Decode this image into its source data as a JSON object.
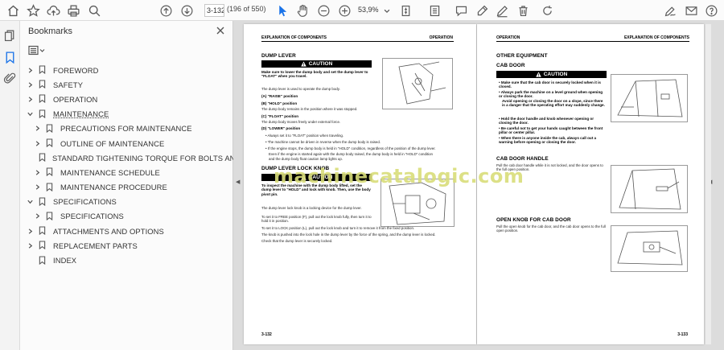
{
  "toolbar": {
    "page_value": "3-132",
    "page_count": "(196 of 550)",
    "zoom_value": "53,9%"
  },
  "sidebar_panel": {
    "title": "Bookmarks",
    "items": [
      {
        "label": "FOREWORD",
        "level": 0,
        "chevron": "right"
      },
      {
        "label": "SAFETY",
        "level": 0,
        "chevron": "right"
      },
      {
        "label": "OPERATION",
        "level": 0,
        "chevron": "right"
      },
      {
        "label": "MAINTENANCE",
        "level": 0,
        "chevron": "down"
      },
      {
        "label": "PRECAUTIONS FOR MAINTENANCE",
        "level": 1,
        "chevron": "right"
      },
      {
        "label": "OUTLINE OF MAINTENANCE",
        "level": 1,
        "chevron": "right"
      },
      {
        "label": "STANDARD TIGHTENING TORQUE FOR BOLTS AND NUTS",
        "level": 1,
        "chevron": "none"
      },
      {
        "label": "MAINTENANCE SCHEDULE",
        "level": 1,
        "chevron": "right"
      },
      {
        "label": "MAINTENANCE PROCEDURE",
        "level": 1,
        "chevron": "right"
      },
      {
        "label": "SPECIFICATIONS",
        "level": 0,
        "chevron": "down"
      },
      {
        "label": "SPECIFICATIONS",
        "level": 1,
        "chevron": "right"
      },
      {
        "label": "ATTACHMENTS AND OPTIONS",
        "level": 0,
        "chevron": "right"
      },
      {
        "label": "REPLACEMENT PARTS",
        "level": 0,
        "chevron": "right"
      },
      {
        "label": "INDEX",
        "level": 0,
        "chevron": "none"
      }
    ]
  },
  "left_page": {
    "header_left": "EXPLANATION OF COMPONENTS",
    "header_right": "OPERATION",
    "section1_title": "DUMP LEVER",
    "caution_label": "CAUTION",
    "caution1_text": "Make sure to lower the dump body and set the dump lever to \"FLOAT\" when you travel.",
    "intro": "The dump lever is used to operate the dump body.",
    "raise_title": "(A) \"RAISE\" position",
    "hold_title": "(B) \"HOLD\" position",
    "hold_text": "The dump body remains in the position where it was stopped.",
    "float_title": "(C) \"FLOAT\" position",
    "float_text": "The dump body moves freely under external force.",
    "lower_title": "(D) \"LOWER\" position",
    "bullet1": "Always set it to \"FLOAT\" position when traveling.",
    "bullet2": "The machine cannot be driven in reverse when the dump body is raised.",
    "bullet3a": "If the engine stops, the dump body is held in \"HOLD\" condition, regardless of the position of the dump lever.",
    "bullet3b": "Even if the engine is started again with the dump body raised, the dump body is held in \"HOLD\" condition",
    "bullet3c": "and the dump body float caution lamp lights up.",
    "section2_title": "DUMP LEVER LOCK KNOB",
    "caution2_text": "To inspect the machine with the dump body lifted, set the dump lever to \"HOLD\" and lock with knob. Then, use the body pivot pin.",
    "lock_text1": "The dump lever lock knob is a locking device for the dump lever.",
    "lock_text2": "To set it to FREE position (F), pull out the lock knob fully, then turn it to hold it in position.",
    "lock_text3": "To set it to LOCK position (L), pull out the lock knob and turn it to remove it from the fixed position.",
    "lock_text4": "The knob is pushed into the lock hole in the dump lever by the force of the spring, and the dump lever is locked.",
    "lock_text5": "Check that the dump lever is securely locked.",
    "page_number": "3-132"
  },
  "right_page": {
    "header_left": "OPERATION",
    "header_right": "EXPLANATION OF COMPONENTS",
    "section_title": "OTHER EQUIPMENT",
    "cab_door_title": "CAB DOOR",
    "caution_label": "CAUTION",
    "cab_bullet1": "Make sure that the cab door is securely locked when it is closed.",
    "cab_bullet2a": "Always park the machine on a level ground when opening or closing the door.",
    "cab_bullet2b": "Avoid opening or closing the door on a slope, since there is a danger that the operating effort may suddenly change.",
    "cab_bullet3": "Hold the door handle and knob whenever opening or closing the door.",
    "cab_bullet4": "Be careful not to get your hands caught between the front pillar or center pillar.",
    "cab_bullet5": "When there is anyone inside the cab, always call out a warning before opening or closing the door.",
    "handle_title": "CAB DOOR HANDLE",
    "handle_text": "Pull the cab door handle while it is not locked, and the door opens to the full open position.",
    "knob_title": "OPEN KNOB FOR CAB DOOR",
    "knob_text": "Pull the open knob for the cab door, and the cab door opens to the full open position.",
    "page_number": "3-133"
  },
  "watermark": "machinecatalogic.com",
  "colors": {
    "accent": "#1a73e8",
    "watermark": "#d9dd7a"
  }
}
